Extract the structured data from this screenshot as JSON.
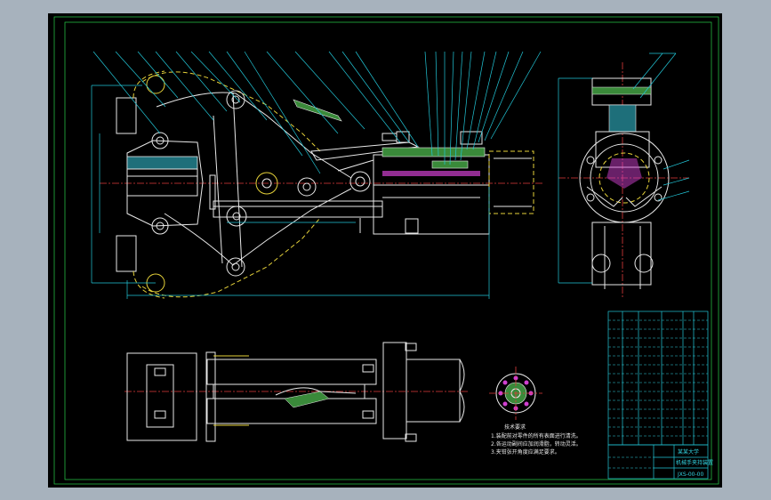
{
  "colors": {
    "window_bg": "#a7b2bd",
    "sheet_bg": "#000000",
    "outline_white": "#e8e8e8",
    "frame_green": "#27d04a",
    "hidden_yellow": "#e6d23a",
    "centerline_red": "#e03b3b",
    "dimension_cyan": "#22c7d8",
    "hatch_green": "#3a8a3a",
    "accent_magenta": "#d040d0"
  },
  "drawing": {
    "views": [
      "main-elevation",
      "side-section",
      "plan-view",
      "flange-detail"
    ],
    "notes_heading": "技术要求",
    "notes": [
      "1.装配前对零件的所有表面进行清洗。",
      "2.各运动副间应加润滑脂，转动灵活。",
      "3.夹钳张开角度应满足要求。"
    ],
    "title_block": {
      "school": "某某大学",
      "drawing_name": "机械手夹持装置",
      "drawing_no": "JXS-00-00"
    }
  }
}
